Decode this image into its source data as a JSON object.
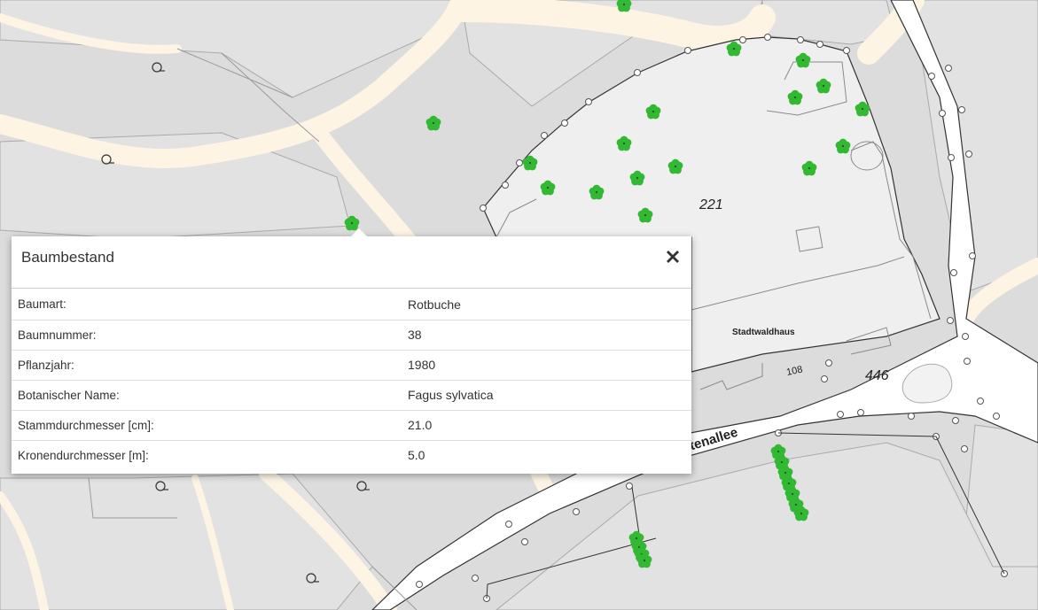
{
  "map": {
    "labels": {
      "parcel_221": "221",
      "parcel_446": "446",
      "parcel_108": "108",
      "building_name": "Stadtwaldhaus",
      "street_fragment": "ttenallee"
    },
    "colors": {
      "background": "#dcdcdc",
      "path": "#fdf4e3",
      "tree": "#33b833",
      "parcel_line": "#333333",
      "site_fill": "#efefef"
    }
  },
  "popup": {
    "title": "Baumbestand",
    "close_icon": "close-icon",
    "rows": [
      {
        "key": "Baumart:",
        "value": "Rotbuche"
      },
      {
        "key": "Baumnummer:",
        "value": "38"
      },
      {
        "key": "Pflanzjahr:",
        "value": "1980"
      },
      {
        "key": "Botanischer Name:",
        "value": "Fagus sylvatica"
      },
      {
        "key": "Stammdurchmesser [cm]:",
        "value": "21.0"
      },
      {
        "key": "Kronendurchmesser [m]:",
        "value": "5.0"
      }
    ]
  }
}
